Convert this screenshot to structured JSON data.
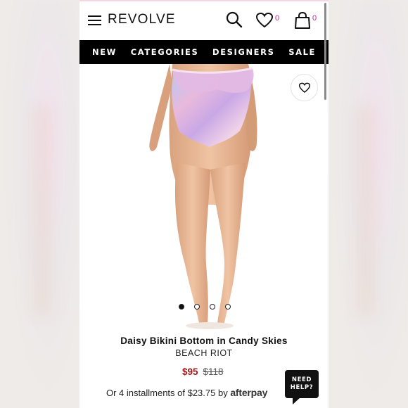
{
  "header": {
    "logo": "REVOLVE",
    "wishlist_count": "0",
    "cart_count": "0"
  },
  "nav": {
    "items": [
      "NEW",
      "CATEGORIES",
      "DESIGNERS",
      "SALE"
    ]
  },
  "product": {
    "title": "Daisy Bikini Bottom in Candy Skies",
    "brand": "BEACH RIOT",
    "sale_price": "$95",
    "original_price": "$118",
    "installments_text": "Or 4 installments of $23.75 by",
    "afterpay_label": "afterpay",
    "image_count": 4,
    "active_image": 1
  },
  "help": {
    "line1": "NEED",
    "line2": "HELP?"
  },
  "colors": {
    "nav_bg": "#000000",
    "badge": "#c0278a",
    "sale_price": "#9c1a1a"
  },
  "icons": [
    "menu-icon",
    "search-icon",
    "heart-icon",
    "shopping-bag-icon",
    "wishlist-heart-icon"
  ]
}
